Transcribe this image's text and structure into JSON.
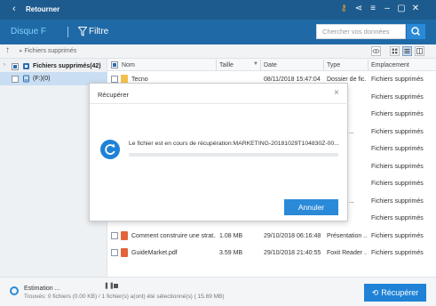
{
  "titlebar": {
    "back_icon": "back-arrow-icon",
    "title": "Retourner",
    "icons": [
      "key-icon",
      "share-icon",
      "menu-icon",
      "minimize-icon",
      "maximize-icon",
      "close-icon"
    ]
  },
  "header": {
    "disk_label": "Disque F",
    "filter_label": "Filtre",
    "search_placeholder": "Chercher vos données"
  },
  "toolbar": {
    "breadcrumb": "Fichiers supprimés"
  },
  "sidebar": {
    "items": [
      {
        "label": "Fichiers supprimés(42)",
        "selected": false
      },
      {
        "label": "(F:)(0)",
        "selected": true
      }
    ]
  },
  "table": {
    "columns": [
      "Nom",
      "Taille",
      "Date",
      "Type",
      "Emplacement"
    ],
    "rows": [
      {
        "name": "Tecno",
        "size": "",
        "date": "08/11/2018 15:47:04",
        "type": "Dossier de fic...",
        "location": "Fichiers supprimés",
        "icon_color": "#f3c14b"
      },
      {
        "name": "",
        "size": "",
        "date": "",
        "type": "",
        "location": "Fichiers supprimés",
        "icon_color": ""
      },
      {
        "name": "",
        "size": "",
        "date": "",
        "type": "",
        "location": "Fichiers supprimés",
        "icon_color": ""
      },
      {
        "name": "",
        "size": "",
        "date": "",
        "type": "Reader ...",
        "location": "Fichiers supprimés",
        "icon_color": ""
      },
      {
        "name": "",
        "size": "",
        "date": "",
        "type": "",
        "location": "Fichiers supprimés",
        "icon_color": ""
      },
      {
        "name": "",
        "size": "",
        "date": "",
        "type": "WinR...",
        "location": "Fichiers supprimés",
        "icon_color": ""
      },
      {
        "name": "",
        "size": "",
        "date": "",
        "type": "",
        "location": "Fichiers supprimés",
        "icon_color": ""
      },
      {
        "name": "",
        "size": "",
        "date": "",
        "type": "Reader ...",
        "location": "Fichiers supprimés",
        "icon_color": ""
      },
      {
        "name": "",
        "size": "",
        "date": "",
        "type": "",
        "location": "Fichiers supprimés",
        "icon_color": ""
      },
      {
        "name": "Comment construire une strat...",
        "size": "1.08 MB",
        "date": "29/10/2018 06:16:48",
        "type": "Présentation ...",
        "location": "Fichiers supprimés",
        "icon_color": "#e2643b"
      },
      {
        "name": "GuideMarket.pdf",
        "size": "3.59 MB",
        "date": "29/10/2018 21:40:55",
        "type": "Foxit Reader ...",
        "location": "Fichiers supprimés",
        "icon_color": "#e2643b"
      }
    ]
  },
  "modal": {
    "title": "Récupérer",
    "message": "Le fichier est en cours de récupération:MARKETING-20181029T104830Z-00...",
    "progress": 0,
    "cancel_label": "Annuler"
  },
  "bottom": {
    "estimation": "Estimation ...",
    "found": "Trouvés: 0 fichiers (0.00 KB) / 1 fichier(s) a(ont) été sélectionné(s) ( 15.69 MB)",
    "recover_label": "Récupérer"
  },
  "colors": {
    "titlebar": "#1d5b8e",
    "header": "#1f6aa6",
    "accent": "#2a8ad8",
    "disk_label": "#7fd0ff"
  }
}
